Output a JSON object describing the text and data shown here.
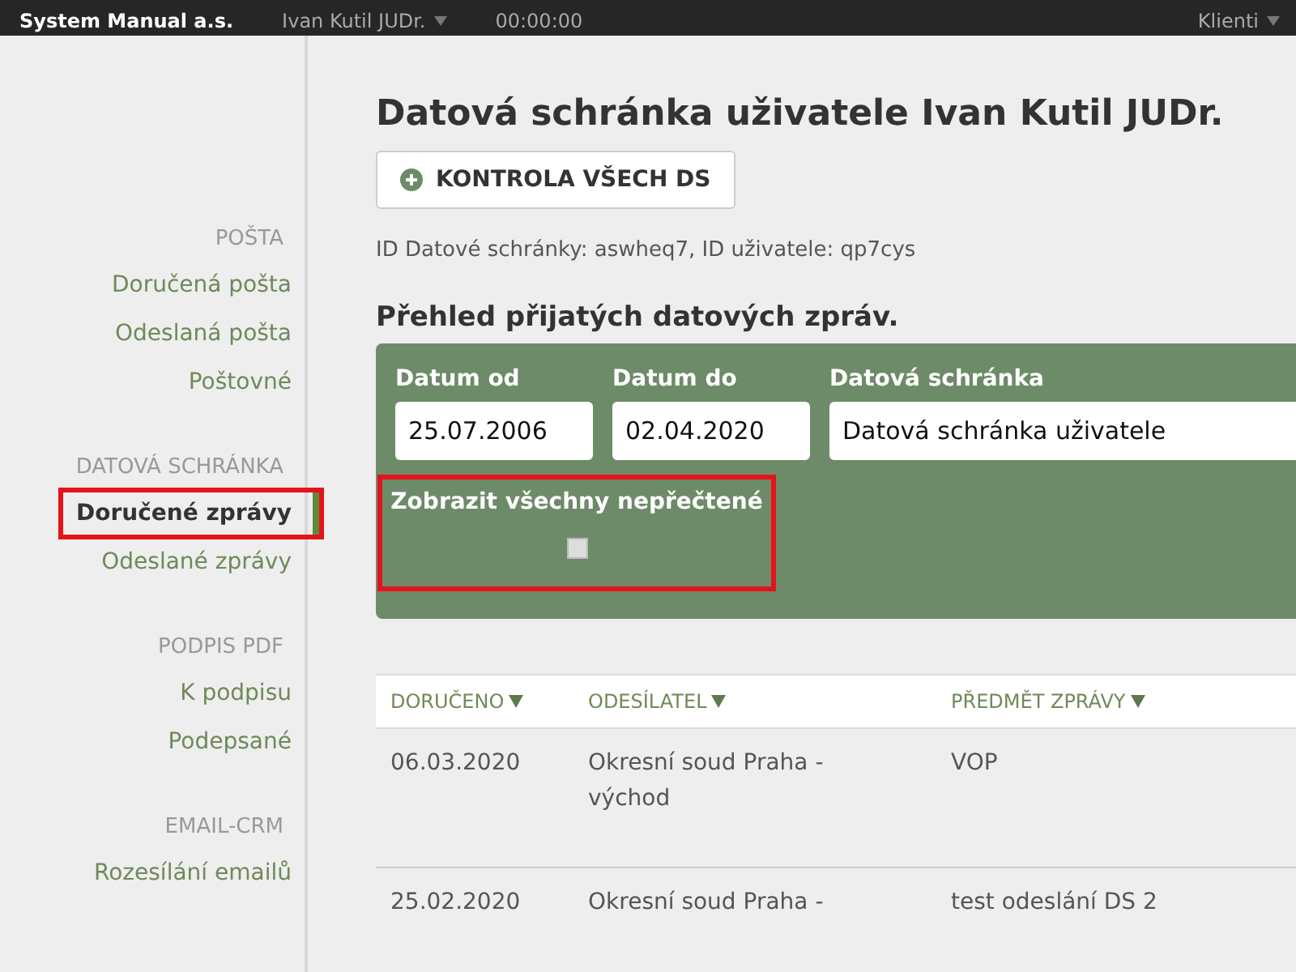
{
  "top_bar": {
    "company": "System Manual a.s.",
    "user": "Ivan Kutil JUDr.",
    "timer": "00:00:00",
    "menu": "Klienti"
  },
  "sidebar": {
    "sections": [
      {
        "heading": "POŠTA",
        "items": [
          {
            "label": "Doručená pošta",
            "selected": false,
            "highlighted": false
          },
          {
            "label": "Odeslaná pošta",
            "selected": false,
            "highlighted": false
          },
          {
            "label": "Poštovné",
            "selected": false,
            "highlighted": false
          }
        ]
      },
      {
        "heading": "DATOVÁ SCHRÁNKA",
        "items": [
          {
            "label": "Doručené zprávy",
            "selected": true,
            "highlighted": true
          },
          {
            "label": "Odeslané zprávy",
            "selected": false,
            "highlighted": false
          }
        ]
      },
      {
        "heading": "PODPIS PDF",
        "items": [
          {
            "label": "K podpisu",
            "selected": false,
            "highlighted": false
          },
          {
            "label": "Podepsané",
            "selected": false,
            "highlighted": false
          }
        ]
      },
      {
        "heading": "EMAIL-CRM",
        "items": [
          {
            "label": "Rozesílání emailů",
            "selected": false,
            "highlighted": false
          }
        ]
      }
    ]
  },
  "page": {
    "title": "Datová schránka uživatele Ivan Kutil JUDr.",
    "button": "KONTROLA VŠECH DS",
    "info": "ID Datové schránky: aswheq7, ID uživatele: qp7cys",
    "section_title": "Přehled přijatých datových zpráv."
  },
  "filters": {
    "fields": [
      {
        "label": "Datum od",
        "value": "25.07.2006",
        "kind": "date"
      },
      {
        "label": "Datum do",
        "value": "02.04.2020",
        "kind": "date"
      },
      {
        "label": "Datová schránka",
        "value": "Datová schránka uživatele",
        "kind": "select"
      }
    ],
    "unread": {
      "label": "Zobrazit všechny nepřečtené",
      "checked": false,
      "highlighted": true
    }
  },
  "table": {
    "columns": [
      "DORUČENO",
      "ODESÍLATEL",
      "PŘEDMĚT ZPRÁVY"
    ],
    "rows": [
      [
        "06.03.2020",
        "Okresní soud Praha - východ",
        "VOP"
      ],
      [
        "25.02.2020",
        "Okresní soud Praha -",
        "test odeslání DS 2"
      ]
    ]
  }
}
